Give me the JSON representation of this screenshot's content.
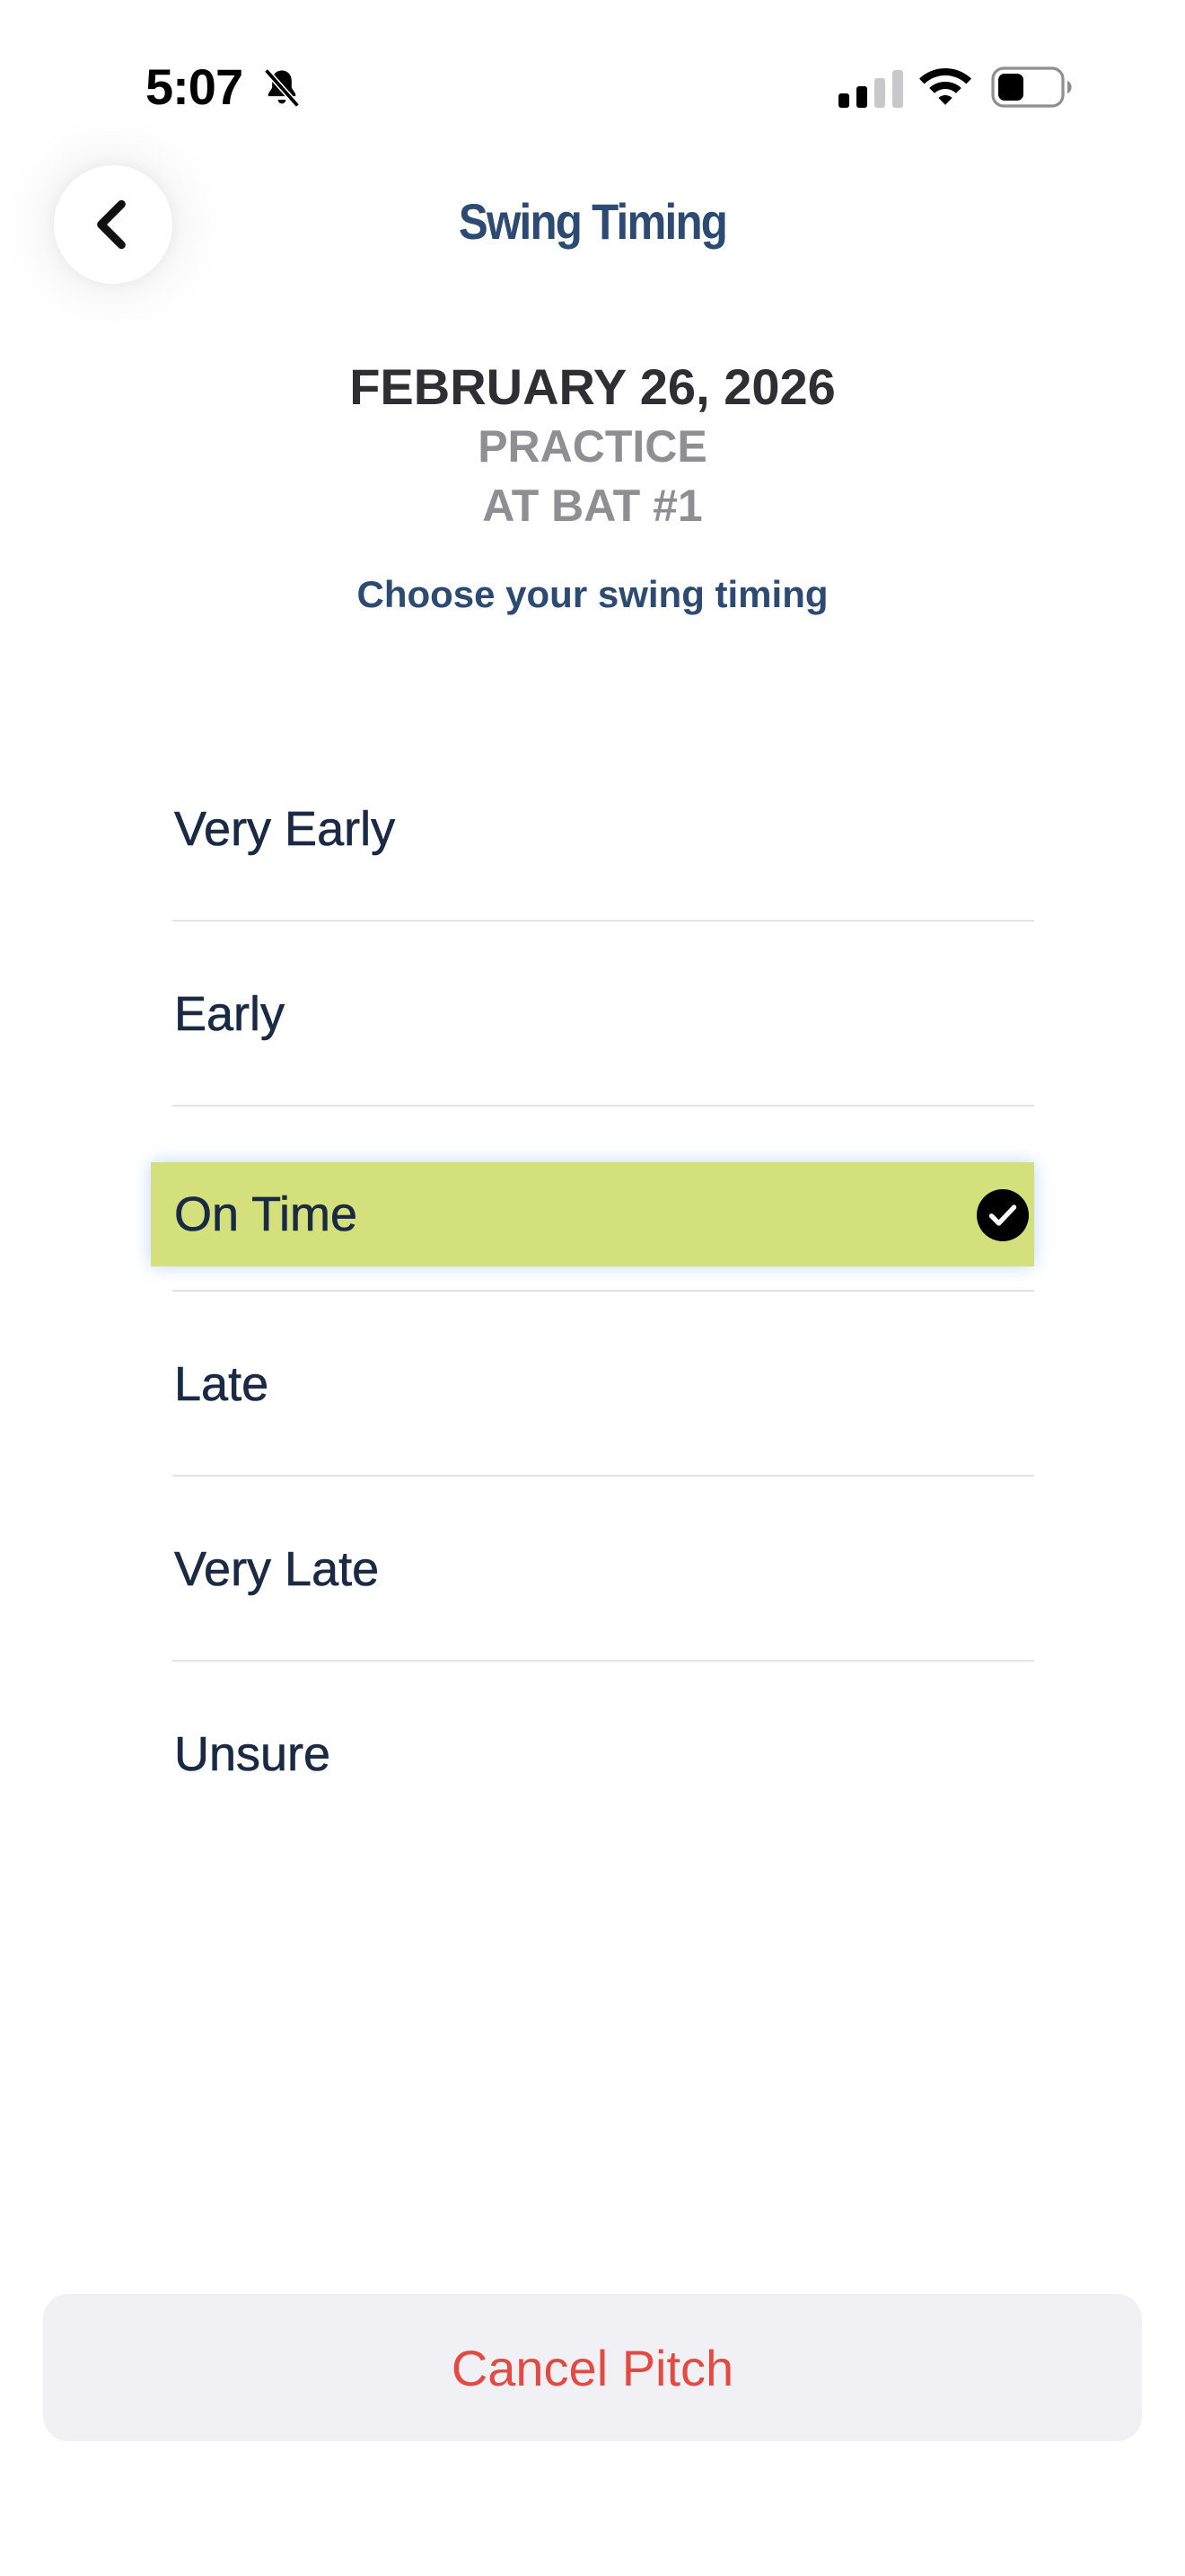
{
  "status_bar": {
    "time": "5:07",
    "icons": [
      "bell-slash-icon",
      "signal-icon",
      "wifi-icon",
      "battery-icon"
    ]
  },
  "header": {
    "title": "Swing Timing",
    "back_icon": "chevron-left-icon"
  },
  "session": {
    "date": "FEBRUARY 26, 2026",
    "type": "PRACTICE",
    "at_bat": "AT BAT #1",
    "instruction": "Choose your swing timing"
  },
  "options": [
    {
      "label": "Very Early",
      "selected": false
    },
    {
      "label": "Early",
      "selected": false
    },
    {
      "label": "On Time",
      "selected": true
    },
    {
      "label": "Late",
      "selected": false
    },
    {
      "label": "Very Late",
      "selected": false
    },
    {
      "label": "Unsure",
      "selected": false
    }
  ],
  "footer": {
    "cancel_label": "Cancel Pitch"
  },
  "colors": {
    "title": "#2c4a72",
    "selected_highlight": "#d4e07b",
    "cancel_text": "#e24b44",
    "option_text": "#1b2a44"
  }
}
